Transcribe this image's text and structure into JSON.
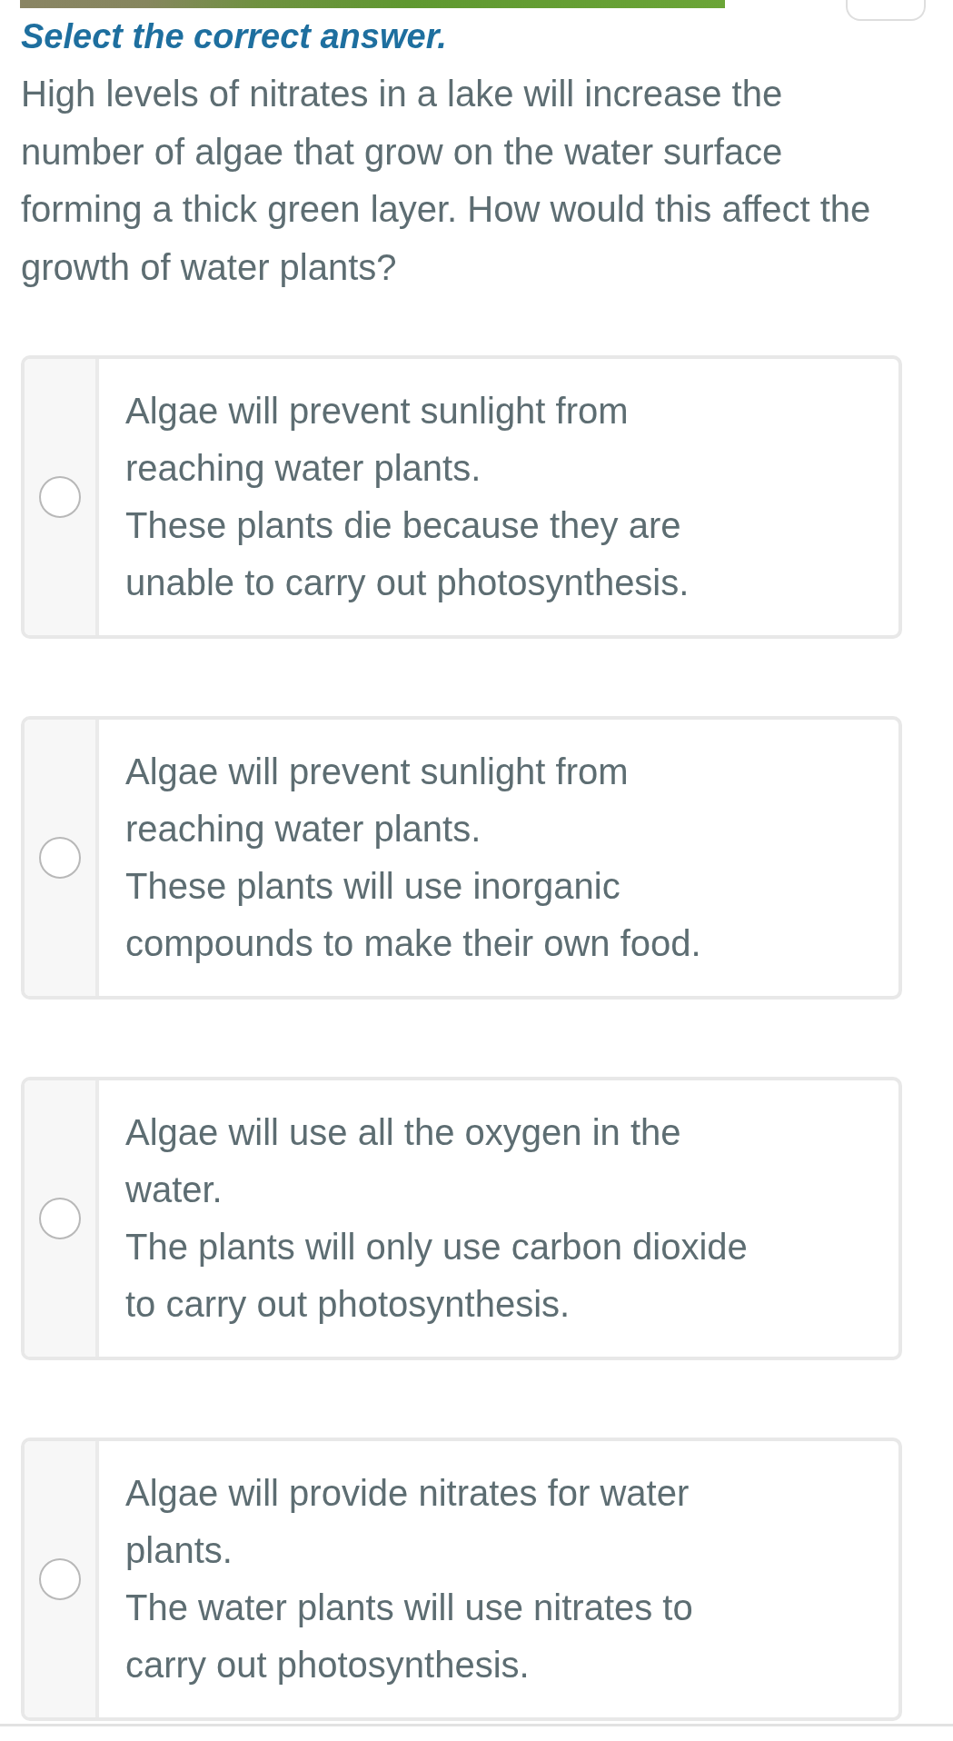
{
  "instruction": "Select the correct answer.",
  "question": "High levels of nitrates in a lake will increase the number of algae that grow on the water surface forming a thick green layer. How would this affect the growth of water plants?",
  "options": [
    {
      "lines": [
        "Algae will prevent sunlight from reaching water plants.",
        "These plants die because they are unable to carry out photosynthesis."
      ],
      "selected": false
    },
    {
      "lines": [
        "Algae will prevent sunlight from reaching water plants.",
        "These plants will use inorganic compounds to make their own food."
      ],
      "selected": false
    },
    {
      "lines": [
        "Algae will use all the oxygen in the water.",
        "The plants will only use carbon dioxide to carry out photosynthesis."
      ],
      "selected": false
    },
    {
      "lines": [
        "Algae will provide nitrates for water plants.",
        "The water plants will use nitrates to carry out photosynthesis."
      ],
      "selected": false
    }
  ]
}
